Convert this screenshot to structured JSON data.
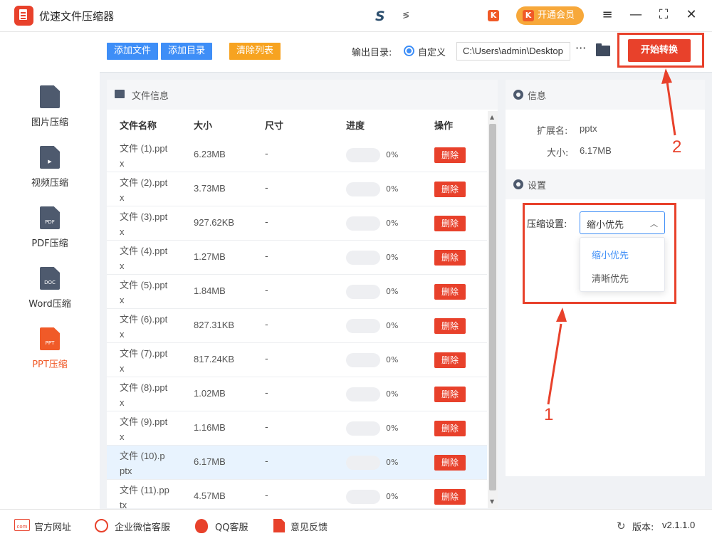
{
  "app": {
    "title": "优速文件压缩器",
    "center_logo": "S",
    "center_logo_sub": "≶",
    "k_icon": "K",
    "vip_label": "开通会员",
    "menu_icon": "≡",
    "minimize_icon": "—",
    "maximize_icon": "⛶",
    "close_icon": "✕"
  },
  "sidebar": {
    "items": [
      {
        "label": "图片压缩",
        "icon_text": "",
        "active": false
      },
      {
        "label": "视频压缩",
        "icon_text": "▶",
        "active": false
      },
      {
        "label": "PDF压缩",
        "icon_text": "PDF",
        "active": false
      },
      {
        "label": "Word压缩",
        "icon_text": "DOC",
        "active": false
      },
      {
        "label": "PPT压缩",
        "icon_text": "PPT",
        "active": true
      }
    ]
  },
  "toolbar": {
    "add_file": "添加文件",
    "add_dir": "添加目录",
    "clear_list": "清除列表",
    "output_label": "输出目录:",
    "custom_label": "自定义",
    "output_path": "C:\\Users\\admin\\Desktop",
    "more": "···",
    "start": "开始转换"
  },
  "file_panel": {
    "title": "文件信息",
    "headers": {
      "name": "文件名称",
      "size": "大小",
      "dim": "尺寸",
      "progress": "进度",
      "action": "操作"
    },
    "delete_label": "删除",
    "rows": [
      {
        "name": "文件 (1).pptx",
        "size": "6.23MB",
        "dim": "-",
        "progress": 0,
        "pct": "0%"
      },
      {
        "name": "文件 (2).pptx",
        "size": "3.73MB",
        "dim": "-",
        "progress": 0,
        "pct": "0%"
      },
      {
        "name": "文件 (3).pptx",
        "size": "927.62KB",
        "dim": "-",
        "progress": 0,
        "pct": "0%"
      },
      {
        "name": "文件 (4).pptx",
        "size": "1.27MB",
        "dim": "-",
        "progress": 0,
        "pct": "0%"
      },
      {
        "name": "文件 (5).pptx",
        "size": "1.84MB",
        "dim": "-",
        "progress": 0,
        "pct": "0%"
      },
      {
        "name": "文件 (6).pptx",
        "size": "827.31KB",
        "dim": "-",
        "progress": 0,
        "pct": "0%"
      },
      {
        "name": "文件 (7).pptx",
        "size": "817.24KB",
        "dim": "-",
        "progress": 0,
        "pct": "0%"
      },
      {
        "name": "文件 (8).pptx",
        "size": "1.02MB",
        "dim": "-",
        "progress": 0,
        "pct": "0%"
      },
      {
        "name": "文件 (9).pptx",
        "size": "1.16MB",
        "dim": "-",
        "progress": 0,
        "pct": "0%"
      },
      {
        "name": "文件 (10).pptx",
        "size": "6.17MB",
        "dim": "-",
        "progress": 0,
        "pct": "0%",
        "selected": true
      },
      {
        "name": "文件 (11).pptx",
        "size": "4.57MB",
        "dim": "-",
        "progress": 0,
        "pct": "0%"
      }
    ]
  },
  "info": {
    "title": "信息",
    "ext_label": "扩展名:",
    "ext_value": "pptx",
    "size_label": "大小:",
    "size_value": "6.17MB"
  },
  "settings": {
    "title": "设置",
    "compress_label": "压缩设置:",
    "selected": "缩小优先",
    "options": [
      "缩小优先",
      "清晰优先"
    ]
  },
  "annotations": {
    "one": "1",
    "two": "2"
  },
  "footer": {
    "website": "官方网址",
    "wechat": "企业微信客服",
    "qq": "QQ客服",
    "feedback": "意见反馈",
    "version_label": "版本:",
    "version_value": "v2.1.1.0",
    "com_icon_text": "com"
  },
  "colors": {
    "accent_red": "#e8412b",
    "accent_blue": "#3e8ef7",
    "accent_orange": "#f7a320"
  }
}
